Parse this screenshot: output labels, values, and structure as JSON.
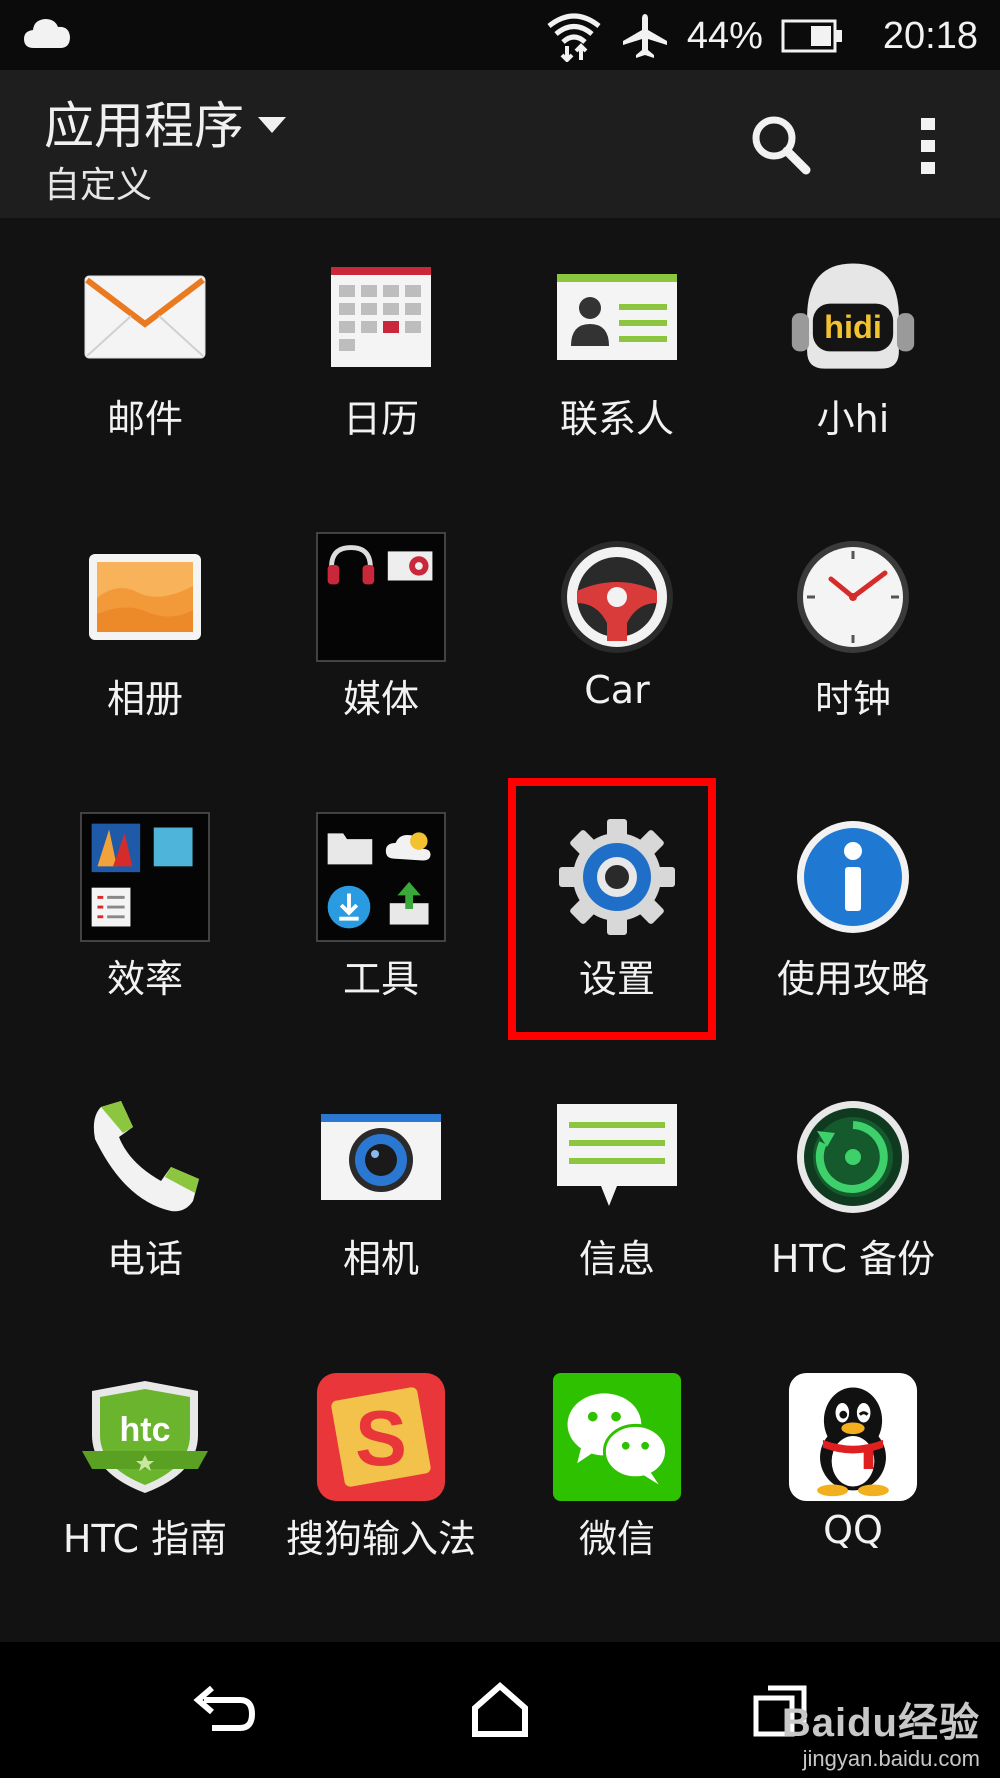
{
  "status_bar": {
    "battery": "44%",
    "time": "20:18",
    "icons": [
      "cloud-icon",
      "wifi-icon",
      "airplane-icon",
      "battery-icon"
    ]
  },
  "header": {
    "title": "应用程序",
    "subtitle": "自定义",
    "icons": [
      "dropdown-icon",
      "search-icon",
      "more-vert-icon"
    ]
  },
  "apps": [
    {
      "label": "邮件",
      "icon": "mail-icon"
    },
    {
      "label": "日历",
      "icon": "calendar-icon"
    },
    {
      "label": "联系人",
      "icon": "contacts-icon"
    },
    {
      "label": "小hi",
      "icon": "hidi-icon"
    },
    {
      "label": "相册",
      "icon": "gallery-icon"
    },
    {
      "label": "媒体",
      "icon": "media-folder-icon"
    },
    {
      "label": "Car",
      "icon": "steering-wheel-icon"
    },
    {
      "label": "时钟",
      "icon": "clock-icon"
    },
    {
      "label": "效率",
      "icon": "productivity-folder-icon"
    },
    {
      "label": "工具",
      "icon": "tools-folder-icon"
    },
    {
      "label": "设置",
      "icon": "settings-gear-icon"
    },
    {
      "label": "使用攻略",
      "icon": "info-icon"
    },
    {
      "label": "电话",
      "icon": "phone-icon"
    },
    {
      "label": "相机",
      "icon": "camera-icon"
    },
    {
      "label": "信息",
      "icon": "messages-icon"
    },
    {
      "label": "HTC 备份",
      "icon": "backup-icon"
    },
    {
      "label": "HTC 指南",
      "icon": "htc-guide-icon"
    },
    {
      "label": "搜狗输入法",
      "icon": "sogou-icon"
    },
    {
      "label": "微信",
      "icon": "wechat-icon"
    },
    {
      "label": "QQ",
      "icon": "qq-penguin-icon"
    }
  ],
  "highlighted_app": "设置",
  "nav_bar": {
    "icons": [
      "back-icon",
      "home-icon",
      "recents-icon"
    ]
  },
  "watermark": {
    "main": "Baidu经验",
    "sub": "jingyan.baidu.com"
  },
  "colors": {
    "background": "#121212",
    "app_bar": "#1e1e1e",
    "highlight": "#ff0000"
  }
}
